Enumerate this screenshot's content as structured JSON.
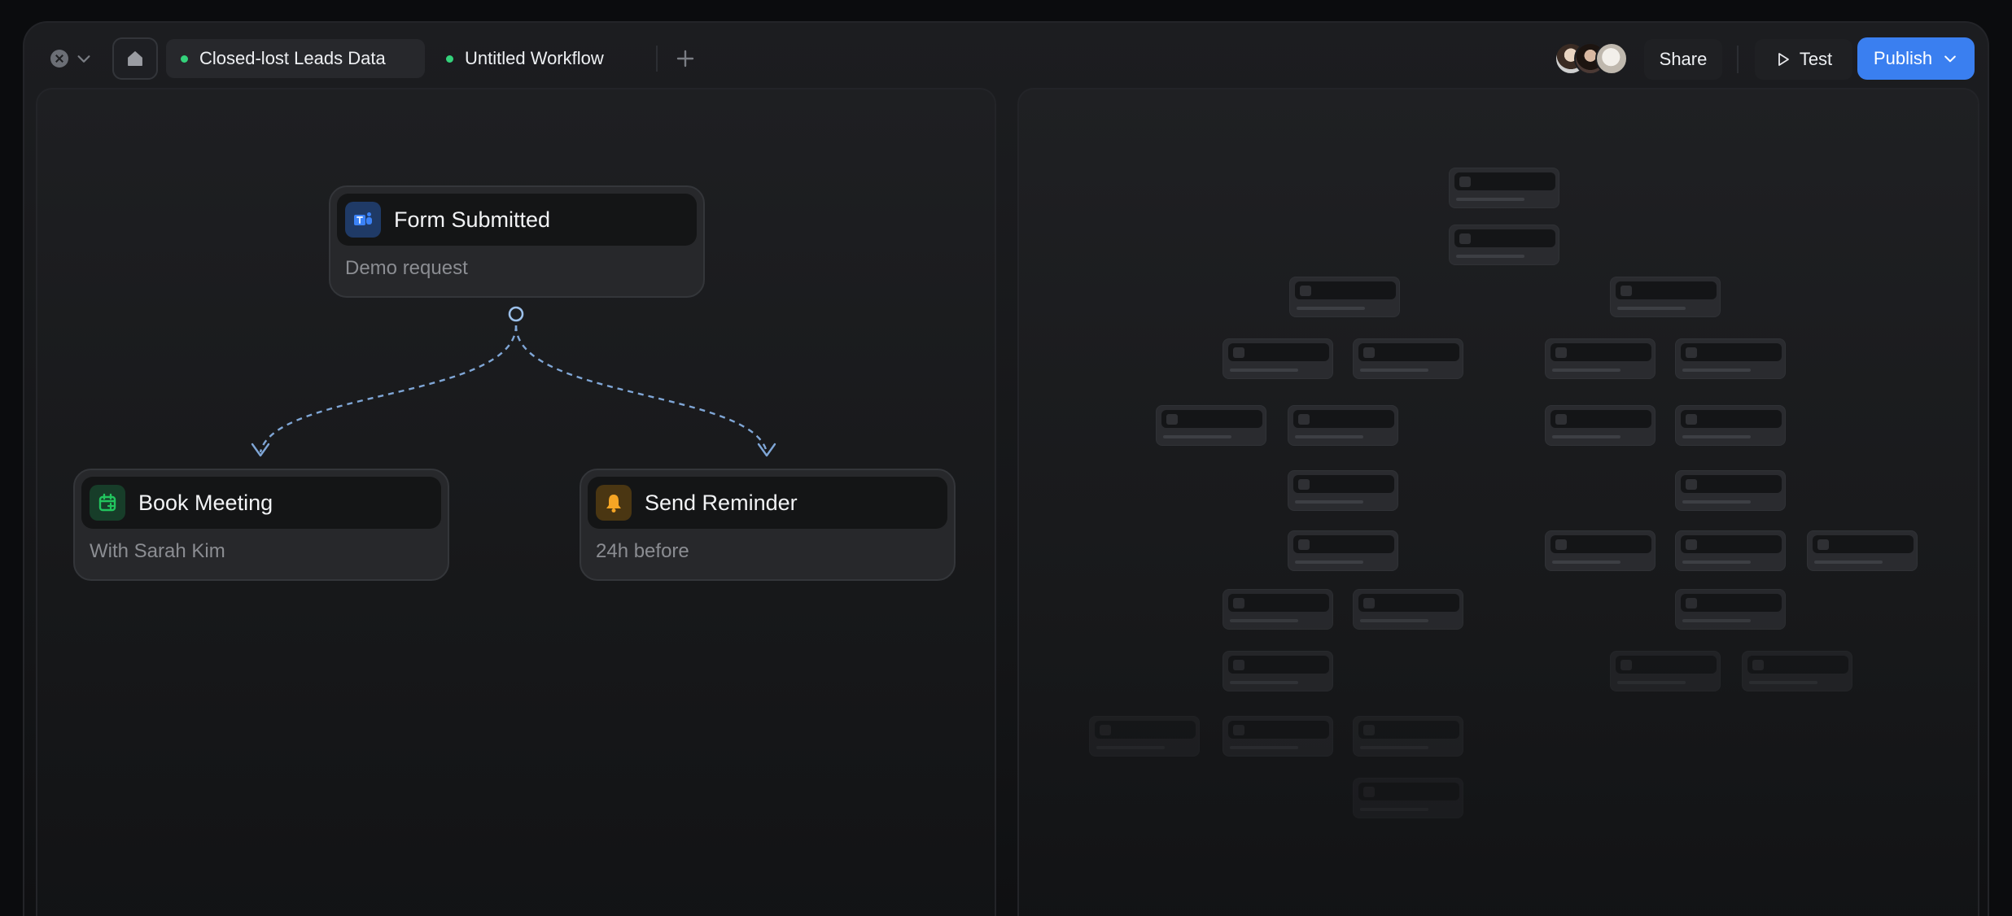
{
  "window": {
    "tabs": [
      {
        "label": "Closed-lost Leads Data",
        "active": true,
        "status_color": "#34d27b"
      },
      {
        "label": "Untitled Workflow",
        "active": false,
        "status_color": "#34d27b"
      }
    ],
    "icons": {
      "close": "close-circle-icon",
      "chevron": "chevron-down-icon",
      "home": "home-icon",
      "add_tab": "plus-icon",
      "test": "play-icon",
      "publish_menu": "chevron-down-icon"
    },
    "collaborators": [
      "avatar-1",
      "avatar-2",
      "avatar-3"
    ],
    "actions": {
      "share_label": "Share",
      "test_label": "Test",
      "publish_label": "Publish",
      "publish_color": "#3a7ff0"
    }
  },
  "workflow": {
    "nodes": [
      {
        "id": "form",
        "title": "Form Submitted",
        "subtitle": "Demo request",
        "icon": "teams-icon",
        "icon_color": "#3b82f6"
      },
      {
        "id": "meeting",
        "title": "Book Meeting",
        "subtitle": "With Sarah Kim",
        "icon": "calendar-icon",
        "icon_color": "#22c55e"
      },
      {
        "id": "reminder",
        "title": "Send Reminder",
        "subtitle": "24h before",
        "icon": "bell-icon",
        "icon_color": "#f5a524"
      }
    ],
    "edge_color": "#7fa6d6"
  }
}
